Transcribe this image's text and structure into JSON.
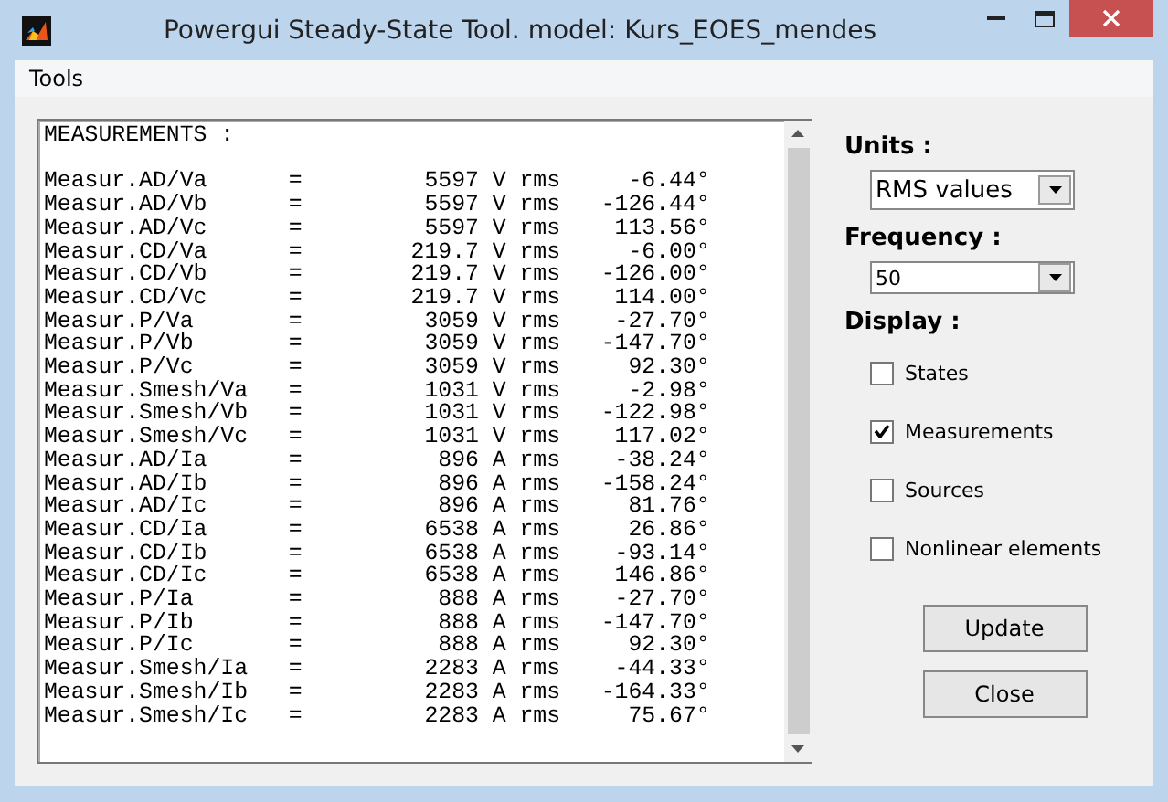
{
  "window": {
    "title": "Powergui Steady-State Tool. model: Kurs_EOES_mendes"
  },
  "menu": [
    "Tools"
  ],
  "output": {
    "header": "MEASUREMENTS :",
    "rows": [
      {
        "name": "Measur.AD/Va",
        "sep": "=",
        "value": "5597",
        "unit": "V rms",
        "angle": "-6.44°"
      },
      {
        "name": "Measur.AD/Vb",
        "sep": "=",
        "value": "5597",
        "unit": "V rms",
        "angle": "-126.44°"
      },
      {
        "name": "Measur.AD/Vc",
        "sep": "=",
        "value": "5597",
        "unit": "V rms",
        "angle": "113.56°"
      },
      {
        "name": "Measur.CD/Va",
        "sep": "=",
        "value": "219.7",
        "unit": "V rms",
        "angle": "-6.00°"
      },
      {
        "name": "Measur.CD/Vb",
        "sep": "=",
        "value": "219.7",
        "unit": "V rms",
        "angle": "-126.00°"
      },
      {
        "name": "Measur.CD/Vc",
        "sep": "=",
        "value": "219.7",
        "unit": "V rms",
        "angle": "114.00°"
      },
      {
        "name": "Measur.P/Va",
        "sep": "=",
        "value": "3059",
        "unit": "V rms",
        "angle": "-27.70°"
      },
      {
        "name": "Measur.P/Vb",
        "sep": "=",
        "value": "3059",
        "unit": "V rms",
        "angle": "-147.70°"
      },
      {
        "name": "Measur.P/Vc",
        "sep": "=",
        "value": "3059",
        "unit": "V rms",
        "angle": "92.30°"
      },
      {
        "name": "Measur.Smesh/Va",
        "sep": "=",
        "value": "1031",
        "unit": "V rms",
        "angle": "-2.98°"
      },
      {
        "name": "Measur.Smesh/Vb",
        "sep": "=",
        "value": "1031",
        "unit": "V rms",
        "angle": "-122.98°"
      },
      {
        "name": "Measur.Smesh/Vc",
        "sep": "=",
        "value": "1031",
        "unit": "V rms",
        "angle": "117.02°"
      },
      {
        "name": "Measur.AD/Ia",
        "sep": "=",
        "value": "896",
        "unit": "A rms",
        "angle": "-38.24°"
      },
      {
        "name": "Measur.AD/Ib",
        "sep": "=",
        "value": "896",
        "unit": "A rms",
        "angle": "-158.24°"
      },
      {
        "name": "Measur.AD/Ic",
        "sep": "=",
        "value": "896",
        "unit": "A rms",
        "angle": "81.76°"
      },
      {
        "name": "Measur.CD/Ia",
        "sep": "=",
        "value": "6538",
        "unit": "A rms",
        "angle": "26.86°"
      },
      {
        "name": "Measur.CD/Ib",
        "sep": "=",
        "value": "6538",
        "unit": "A rms",
        "angle": "-93.14°"
      },
      {
        "name": "Measur.CD/Ic",
        "sep": "=",
        "value": "6538",
        "unit": "A rms",
        "angle": "146.86°"
      },
      {
        "name": "Measur.P/Ia",
        "sep": "=",
        "value": "888",
        "unit": "A rms",
        "angle": "-27.70°"
      },
      {
        "name": "Measur.P/Ib",
        "sep": "=",
        "value": "888",
        "unit": "A rms",
        "angle": "-147.70°"
      },
      {
        "name": "Measur.P/Ic",
        "sep": "=",
        "value": "888",
        "unit": "A rms",
        "angle": "92.30°"
      },
      {
        "name": "Measur.Smesh/Ia",
        "sep": "=",
        "value": "2283",
        "unit": "A rms",
        "angle": "-44.33°"
      },
      {
        "name": "Measur.Smesh/Ib",
        "sep": "=",
        "value": "2283",
        "unit": "A rms",
        "angle": "-164.33°"
      },
      {
        "name": "Measur.Smesh/Ic",
        "sep": "=",
        "value": "2283",
        "unit": "A rms",
        "angle": "75.67°"
      }
    ]
  },
  "units": {
    "label": "Units :",
    "value": "RMS values"
  },
  "frequency": {
    "label": "Frequency :",
    "value": "50"
  },
  "display": {
    "label": "Display :",
    "options": [
      {
        "label": "States",
        "checked": false
      },
      {
        "label": "Measurements",
        "checked": true
      },
      {
        "label": "Sources",
        "checked": false
      },
      {
        "label": "Nonlinear elements",
        "checked": false
      }
    ]
  },
  "buttons": [
    "Update",
    "Close"
  ]
}
